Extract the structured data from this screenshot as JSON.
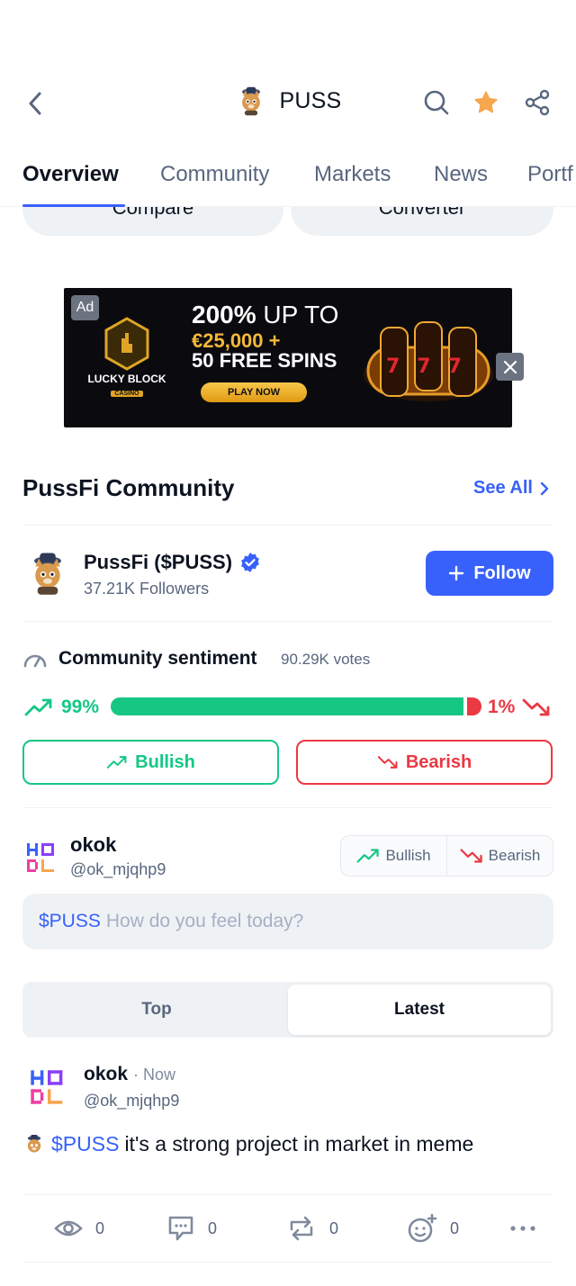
{
  "header": {
    "title": "PUSS"
  },
  "tabs": [
    {
      "label": "Overview"
    },
    {
      "label": "Community"
    },
    {
      "label": "Markets"
    },
    {
      "label": "News"
    },
    {
      "label": "Portf"
    }
  ],
  "quick_buttons": {
    "compare": "Compare",
    "converter": "Converter"
  },
  "ad": {
    "badge": "Ad",
    "headline_bold": "200%",
    "headline_rest": "UP TO",
    "amount": "€25,000 +",
    "spins": "50 FREE SPINS",
    "cta": "PLAY NOW",
    "brand": "LUCKY BLOCK",
    "brand_sub": "CASINO",
    "reels": "777"
  },
  "community": {
    "section_title": "PussFi Community",
    "see_all": "See All",
    "name": "PussFi ($PUSS)",
    "followers": "37.21K Followers",
    "follow_label": "Follow"
  },
  "sentiment": {
    "title": "Community sentiment",
    "votes": "90.29K votes",
    "bullish_pct_label": "99%",
    "bearish_pct_label": "1%",
    "bullish_fraction": 0.99,
    "bullish_label": "Bullish",
    "bearish_label": "Bearish",
    "colors": {
      "bullish": "#16c784",
      "bearish": "#ea3943"
    }
  },
  "composer": {
    "user_name": "okok",
    "user_handle": "@ok_mjqhp9",
    "toggle_bullish": "Bullish",
    "toggle_bearish": "Bearish",
    "input_tag": "$PUSS",
    "input_placeholder": "How do you feel today?"
  },
  "feed_tabs": [
    {
      "label": "Top",
      "active": false
    },
    {
      "label": "Latest",
      "active": true
    }
  ],
  "post": {
    "user_name": "okok",
    "time": "· Now",
    "handle": "@ok_mjqhp9",
    "tag": "$PUSS",
    "text": "it's a strong project in market in meme",
    "views": "0",
    "comments": "0",
    "reposts": "0",
    "reactions": "0"
  },
  "accent_color": "#3861fb"
}
